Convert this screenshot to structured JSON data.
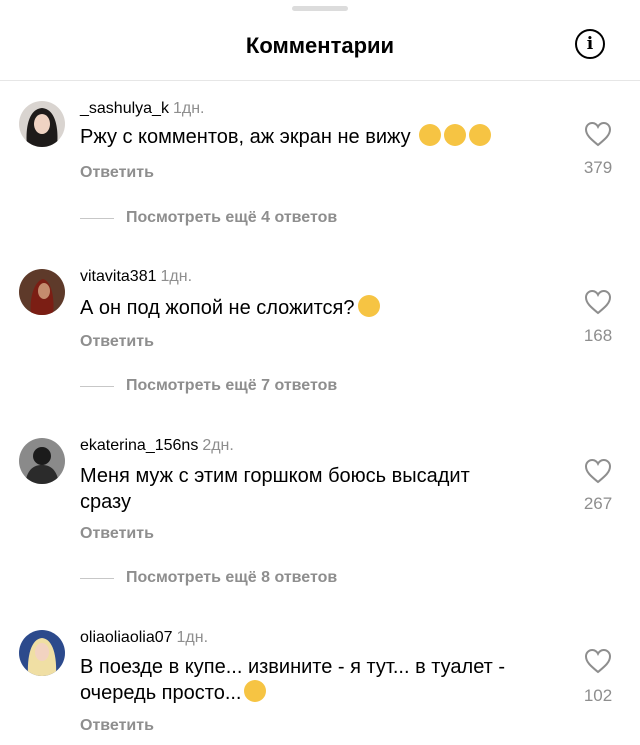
{
  "header": {
    "title": "Комментарии"
  },
  "icons": {
    "info": "info-icon",
    "like": "heart-icon"
  },
  "comments": [
    {
      "username": "_sashulya_k",
      "time": "1дн.",
      "text": "Ржу с комментов, аж экран не вижу",
      "emoji_count": 3,
      "reply": "Ответить",
      "likes": "379",
      "more": "Посмотреть ещё 4 ответов"
    },
    {
      "username": "vitavita381",
      "time": "1дн.",
      "text": "А он под жопой не сложится?",
      "emoji_count": 1,
      "reply": "Ответить",
      "likes": "168",
      "more": "Посмотреть ещё 7 ответов"
    },
    {
      "username": "ekaterina_156ns",
      "time": "2дн.",
      "text": "Меня муж с этим горшком боюсь высадит сразу",
      "emoji_count": 0,
      "reply": "Ответить",
      "likes": "267",
      "more": "Посмотреть ещё 8 ответов"
    },
    {
      "username": "oliaoliaolia07",
      "time": "1дн.",
      "text": "В поезде в купе... извините - я тут... в туалет - очередь просто...",
      "emoji_count": 1,
      "reply": "Ответить",
      "likes": "102"
    }
  ]
}
